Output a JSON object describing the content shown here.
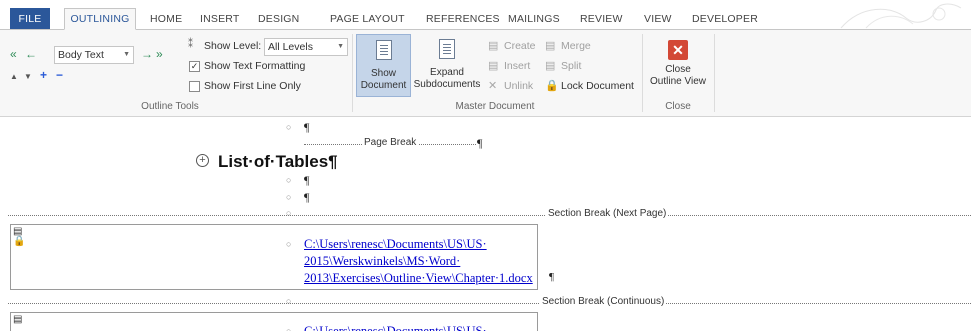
{
  "tabs": {
    "file": "FILE",
    "outlining": "OUTLINING",
    "home": "HOME",
    "insert": "INSERT",
    "design": "DESIGN",
    "page_layout": "PAGE LAYOUT",
    "references": "REFERENCES",
    "mailings": "MAILINGS",
    "review": "REVIEW",
    "view": "VIEW",
    "developer": "DEVELOPER"
  },
  "outline_tools": {
    "level_value": "Body Text",
    "show_level_label": "Show Level:",
    "show_level_value": "All Levels",
    "show_text_formatting": "Show Text Formatting",
    "show_text_formatting_checked": true,
    "show_first_line_only": "Show First Line Only",
    "show_first_line_only_checked": false,
    "group_label": "Outline Tools",
    "icons": [
      "promote-to-heading-1-icon",
      "promote-icon",
      "demote-icon",
      "demote-to-body-text-icon",
      "move-up-icon",
      "move-down-icon",
      "expand-icon",
      "collapse-icon"
    ]
  },
  "master_document": {
    "show_document": "Show\nDocument",
    "expand_subdocuments": "Expand\nSubdocuments",
    "create": "Create",
    "merge": "Merge",
    "insert": "Insert",
    "split": "Split",
    "unlink": "Unlink",
    "lock_document": "Lock Document",
    "group_label": "Master Document"
  },
  "close": {
    "close_outline_view": "Close\nOutline View",
    "group_label": "Close"
  },
  "document": {
    "pilcrow": "¶",
    "page_break": "Page Break",
    "heading": "List·of·Tables¶",
    "section_break_next": "Section Break (Next Page)",
    "section_break_continuous": "Section Break (Continuous)",
    "subdoc_link_1": "C:\\Users\\renesc\\Documents\\US\\US·",
    "subdoc_link_2": "2015\\Werskwinkels\\MS·Word·",
    "subdoc_link_3": "2013\\Exercises\\Outline·View\\Chapter·1.docx",
    "subdoc_link_3_end": "¶",
    "subdoc2_link_partial": "C:\\Users\\renesc\\Documents\\US\\US·"
  },
  "colors": {
    "accent": "#2b579a",
    "ribbon_bg": "#f7f7f7",
    "link": "#0000cc",
    "close_red": "#d34836"
  }
}
